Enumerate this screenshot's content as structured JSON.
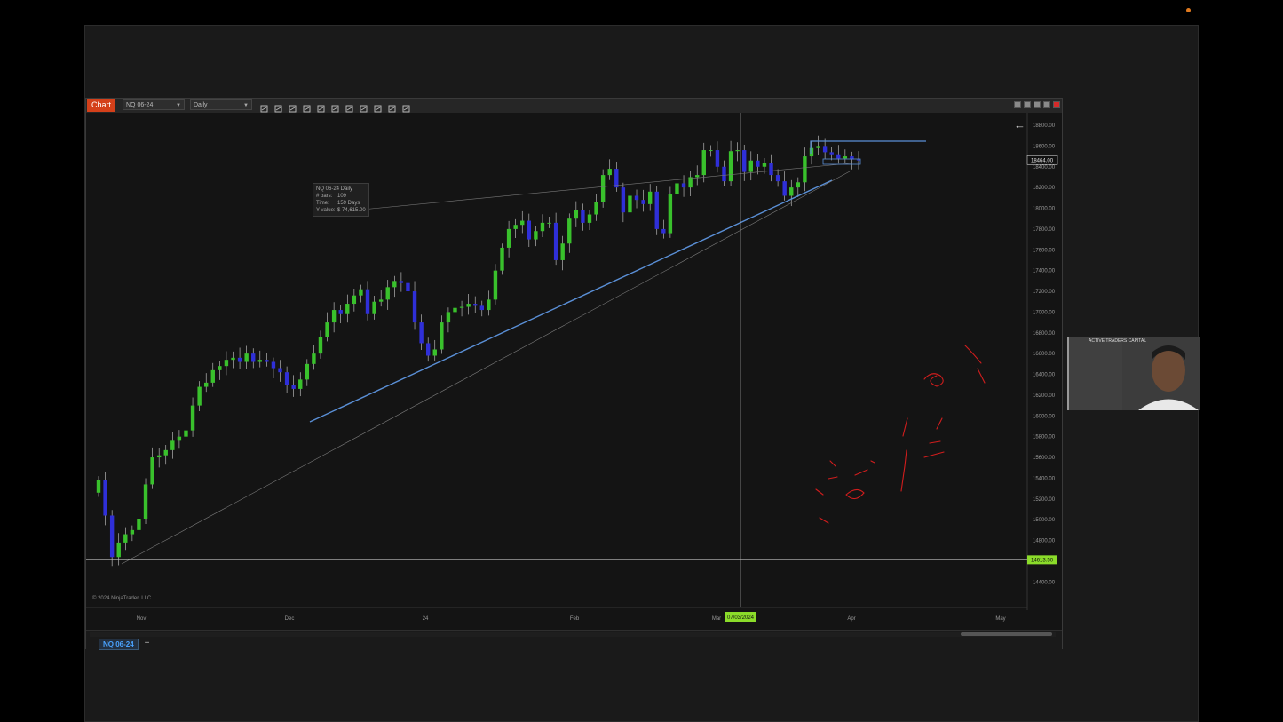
{
  "window": {
    "tab_label": "Chart",
    "instrument": "NQ 06-24",
    "timeframe": "Daily"
  },
  "toolbar_icons": [
    "bar-type-icon",
    "pencil-icon",
    "zoom-in-icon",
    "zoom-out-icon",
    "crosshair-icon",
    "data-box-icon",
    "properties-icon",
    "strategy-icon",
    "indicators-icon",
    "calculator-icon",
    "list-icon"
  ],
  "window_controls": [
    "tile-icon",
    "layout-icon",
    "minimize-icon",
    "restore-icon",
    "close-icon"
  ],
  "cursor_info": {
    "title": "NQ 06-24 Daily",
    "rows": [
      {
        "key": "# bars:",
        "value": "109"
      },
      {
        "key": "Time:",
        "value": "159 Days"
      },
      {
        "key": "Y value:",
        "value": "$ 74,615.00"
      }
    ]
  },
  "copyright": "© 2024 NinjaTrader, LLC",
  "bottom_tabs": {
    "instrument": "NQ 06-24",
    "add": "+"
  },
  "webcam_label": "ACTIVE TRADERS CAPITAL",
  "colors": {
    "up": "#39c12c",
    "down": "#2f2fd8",
    "trend": "#5a8fd6",
    "last_price": "#8bdc2a",
    "annotation": "#d11d1d"
  },
  "chart_data": {
    "type": "candlestick",
    "ylim": [
      14300,
      18800
    ],
    "yticks": [
      "18800.00",
      "18600.00",
      "18400.00",
      "18200.00",
      "18000.00",
      "17800.00",
      "17600.00",
      "17400.00",
      "17200.00",
      "17000.00",
      "16800.00",
      "16600.00",
      "16400.00",
      "16200.00",
      "16000.00",
      "15800.00",
      "15600.00",
      "15400.00",
      "15200.00",
      "15000.00",
      "14800.00",
      "14600.00",
      "14400.00"
    ],
    "xticks": [
      "Nov",
      "Dec",
      "24",
      "Feb",
      "Mar",
      "Apr",
      "May"
    ],
    "cursor_date": "07/03/2024",
    "last_price_label": "18464.00",
    "crosshair_price_label": "14613.50",
    "crosshair_price": 14613.5,
    "closes": [
      15380,
      15040,
      14640,
      14780,
      14860,
      14900,
      15010,
      15340,
      15600,
      15620,
      15670,
      15760,
      15800,
      15860,
      16100,
      16280,
      16320,
      16440,
      16480,
      16540,
      16560,
      16520,
      16600,
      16520,
      16540,
      16520,
      16460,
      16420,
      16300,
      16260,
      16350,
      16500,
      16600,
      16760,
      16900,
      17020,
      16980,
      17080,
      17160,
      17220,
      16980,
      17100,
      17120,
      17240,
      17300,
      17280,
      17200,
      16900,
      16700,
      16580,
      16640,
      16900,
      17000,
      17040,
      17050,
      17080,
      17060,
      17020,
      17120,
      17400,
      17620,
      17800,
      17840,
      17880,
      17700,
      17780,
      17860,
      17860,
      17500,
      17660,
      17900,
      17980,
      17860,
      17940,
      18060,
      18320,
      18380,
      18200,
      17960,
      18120,
      18080,
      18040,
      18160,
      17800,
      17760,
      18140,
      18240,
      18200,
      18300,
      18320,
      18560,
      18560,
      18400,
      18260,
      18550,
      18560,
      18350,
      18460,
      18400,
      18440,
      18320,
      18260,
      18120,
      18200,
      18250,
      18500,
      18580,
      18600,
      18540,
      18520,
      18480,
      18500,
      18470,
      18464
    ]
  }
}
